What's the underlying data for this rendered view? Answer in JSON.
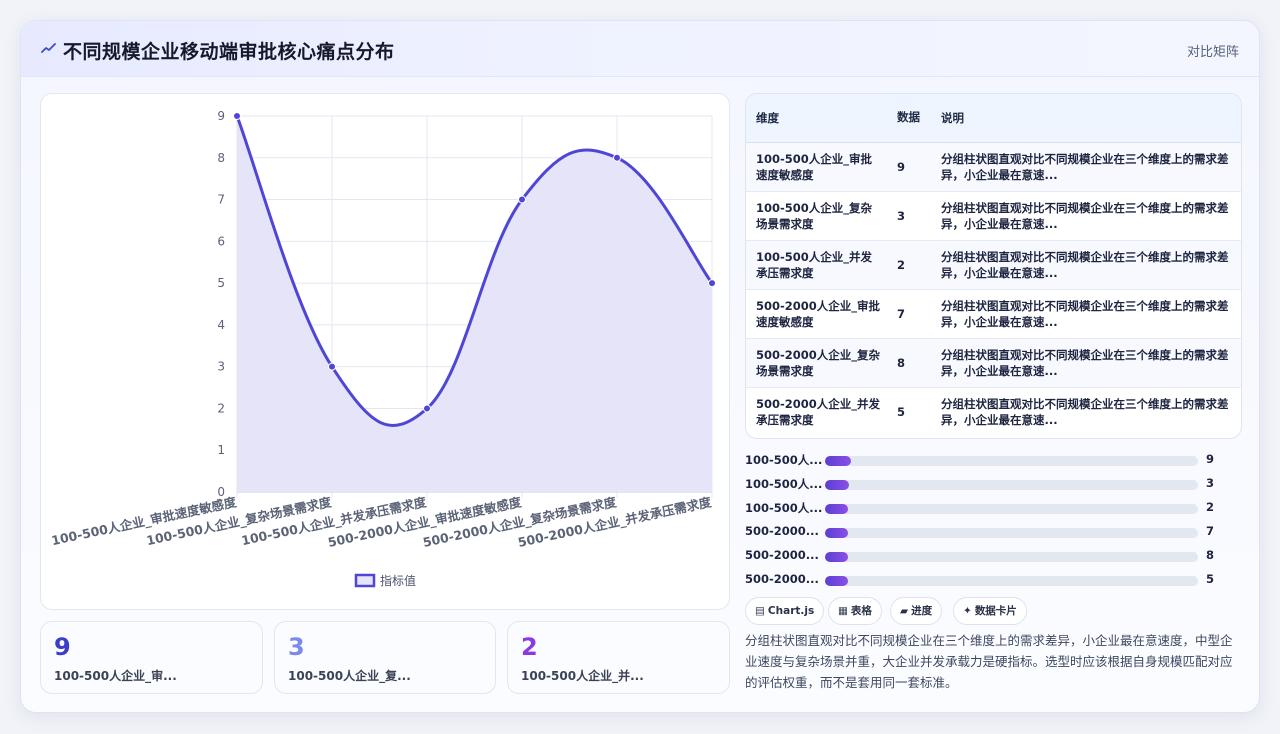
{
  "header": {
    "title": "不同规模企业移动端审批核心痛点分布",
    "tag": "对比矩阵",
    "icon": "trend-line-icon"
  },
  "chart_data": {
    "type": "line",
    "categories": [
      "100-500人企业_审批速度敏感度",
      "100-500人企业_复杂场景需求度",
      "100-500人企业_并发承压需求度",
      "500-2000人企业_审批速度敏感度",
      "500-2000人企业_复杂场景需求度",
      "500-2000人企业_并发承压需求度"
    ],
    "series": [
      {
        "name": "指标值",
        "values": [
          9,
          3,
          2,
          7,
          8,
          5
        ]
      }
    ],
    "ylim": [
      0,
      9
    ],
    "yticks": [
      "0",
      "1",
      "2",
      "3",
      "4",
      "5",
      "6",
      "7",
      "8",
      "9"
    ],
    "grid": true,
    "legend_position": "bottom",
    "line_color": "#4f46d6",
    "fill_color": "#e6e4f8"
  },
  "kpis": [
    {
      "value": "9",
      "label": "100-500人企业_审...",
      "color": "#3b3ec9"
    },
    {
      "value": "3",
      "label": "100-500人企业_复...",
      "color": "#7b8ae8"
    },
    {
      "value": "2",
      "label": "100-500人企业_并...",
      "color": "#8a3be0"
    }
  ],
  "table": {
    "headers": {
      "dim": "维度",
      "data": "数据",
      "desc": "说明"
    },
    "rows": [
      {
        "dim": "100-500人企业_审批速度敏感度",
        "val": "9",
        "desc": "分组柱状图直观对比不同规模企业在三个维度上的需求差异，小企业最在意速..."
      },
      {
        "dim": "100-500人企业_复杂场景需求度",
        "val": "3",
        "desc": "分组柱状图直观对比不同规模企业在三个维度上的需求差异，小企业最在意速..."
      },
      {
        "dim": "100-500人企业_并发承压需求度",
        "val": "2",
        "desc": "分组柱状图直观对比不同规模企业在三个维度上的需求差异，小企业最在意速..."
      },
      {
        "dim": "500-2000人企业_审批速度敏感度",
        "val": "7",
        "desc": "分组柱状图直观对比不同规模企业在三个维度上的需求差异，小企业最在意速..."
      },
      {
        "dim": "500-2000人企业_复杂场景需求度",
        "val": "8",
        "desc": "分组柱状图直观对比不同规模企业在三个维度上的需求差异，小企业最在意速..."
      },
      {
        "dim": "500-2000人企业_并发承压需求度",
        "val": "5",
        "desc": "分组柱状图直观对比不同规模企业在三个维度上的需求差异，小企业最在意速..."
      }
    ]
  },
  "progress": [
    {
      "label": "100-500人...",
      "value": "9",
      "fraction": 0.07
    },
    {
      "label": "100-500人...",
      "value": "3",
      "fraction": 0.065
    },
    {
      "label": "100-500人...",
      "value": "2",
      "fraction": 0.062
    },
    {
      "label": "500-2000...",
      "value": "7",
      "fraction": 0.062
    },
    {
      "label": "500-2000...",
      "value": "8",
      "fraction": 0.062
    },
    {
      "label": "500-2000...",
      "value": "5",
      "fraction": 0.062
    }
  ],
  "chips": [
    {
      "icon": "▤",
      "label": "Chart.js",
      "icon_name": "chart-icon"
    },
    {
      "icon": "▦",
      "label": "表格",
      "icon_name": "table-icon"
    },
    {
      "icon": "▰",
      "label": "进度",
      "icon_name": "progress-icon"
    },
    {
      "icon": "✦",
      "label": "数据卡片",
      "icon_name": "sparkle-icon"
    }
  ],
  "summary": "分组柱状图直观对比不同规模企业在三个维度上的需求差异，小企业最在意速度，中型企业速度与复杂场景并重，大企业并发承载力是硬指标。选型时应该根据自身规模匹配对应的评估权重，而不是套用同一套标准。"
}
